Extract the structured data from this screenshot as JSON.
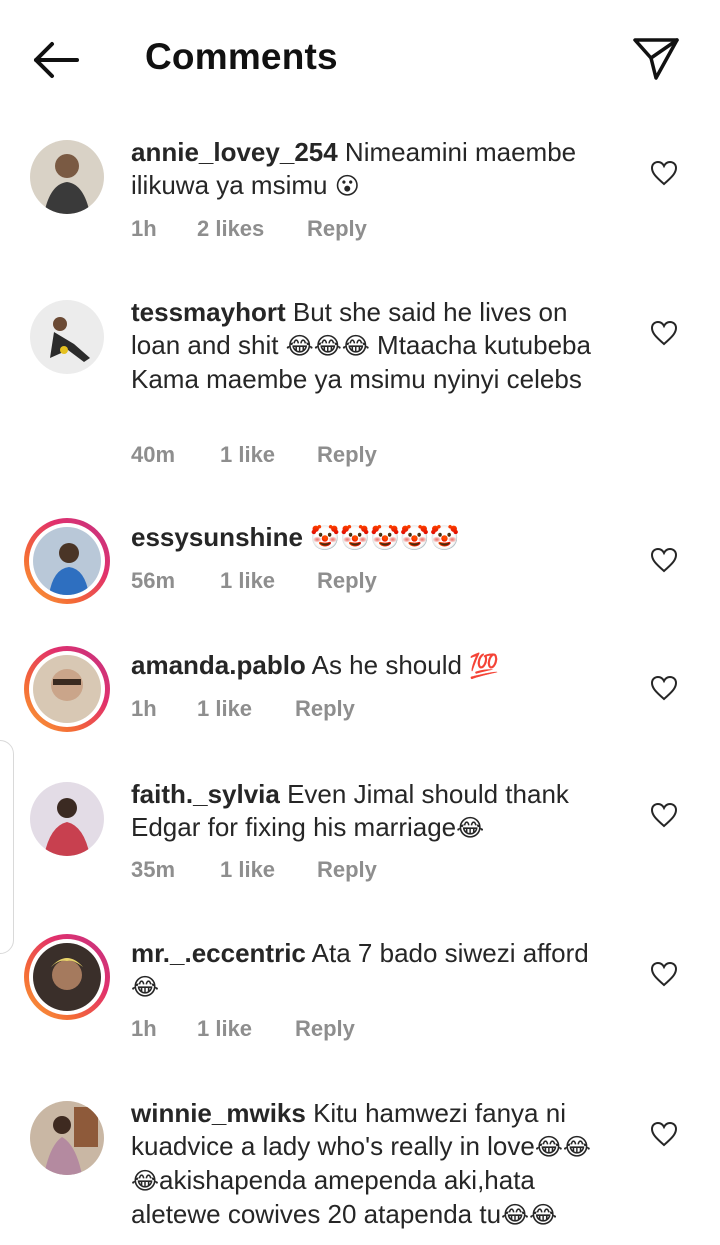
{
  "header": {
    "title": "Comments"
  },
  "comments": [
    {
      "username": "annie_lovey_254",
      "text": " Nimeamini maembe ilikuwa ya msimu ",
      "emoji_tail": "😮",
      "time": "1h",
      "likes": "2 likes",
      "reply": "Reply"
    },
    {
      "username": "tessmayhort",
      "text": " But she said he lives on loan and shit ",
      "emoji_mid": "😂😂😂",
      "text2": " Mtaacha kutubeba Kama maembe ya msimu nyinyi celebs",
      "time": "40m",
      "likes": "1 like",
      "reply": "Reply"
    },
    {
      "username": "essysunshine",
      "text": " ",
      "emoji_tail": "🤡🤡🤡🤡🤡",
      "time": "56m",
      "likes": "1 like",
      "reply": "Reply"
    },
    {
      "username": "amanda.pablo",
      "text": " As he should ",
      "emoji_tail": "💯",
      "time": "1h",
      "likes": "1 like",
      "reply": "Reply"
    },
    {
      "username": "faith._sylvia",
      "text": " Even Jimal should thank Edgar for fixing his marriage",
      "emoji_tail": "😂",
      "time": "35m",
      "likes": "1 like",
      "reply": "Reply"
    },
    {
      "username": "mr._.eccentric",
      "text": " Ata 7 bado siwezi afford ",
      "emoji_tail": "😂",
      "time": "1h",
      "likes": "1 like",
      "reply": "Reply"
    },
    {
      "username": "winnie_mwiks",
      "text": " Kitu hamwezi fanya ni kuadvice a lady who's really in love",
      "emoji_mid": "😂😂😂",
      "text2": "akishapenda amependa aki,hata aletewe cowives 20 atapenda tu",
      "emoji_tail": "😂😂"
    }
  ],
  "icons": {
    "back": "arrow-left-icon",
    "send": "paper-plane-icon",
    "like": "heart-outline-icon"
  },
  "colors": {
    "meta_text": "#8e8e8e",
    "story_ring_start": "#f9a13b",
    "story_ring_end": "#c13584"
  }
}
